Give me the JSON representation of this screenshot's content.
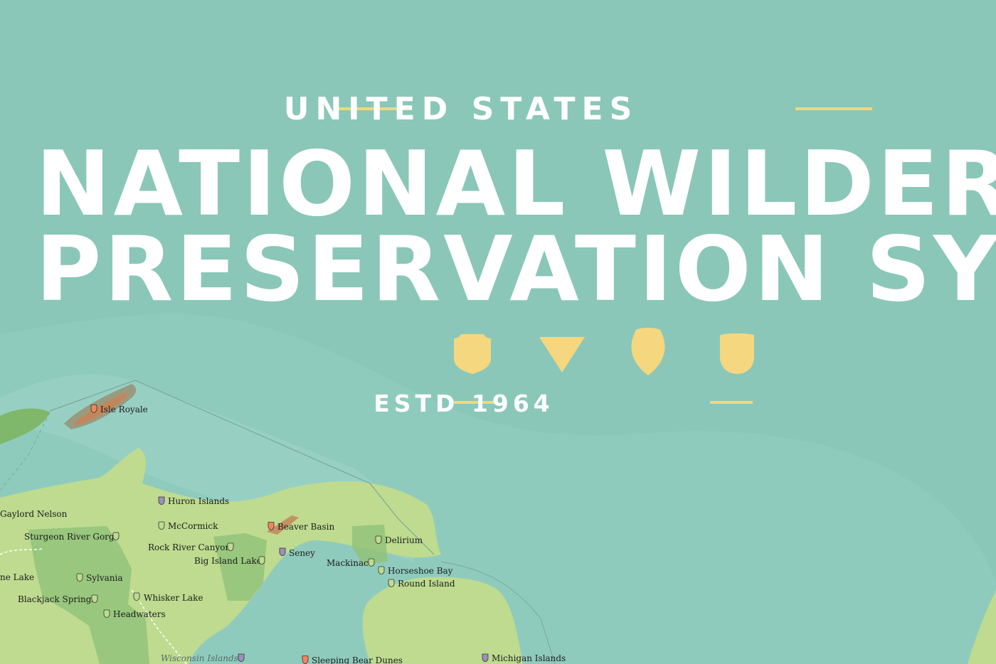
{
  "title": {
    "country": "UNITED STATES",
    "line1": "NATIONAL WILDERNESS",
    "line2": "PRESERVATION SYSTEM",
    "established": "ESTD 1964"
  },
  "colors": {
    "water": "#8fcbbd",
    "land_light": "#bedb8f",
    "land_forest": "#92c37a",
    "title_text": "#ffffff",
    "accent_gold": "#f4d77e",
    "nps_marker": "#f0865c",
    "fws_marker": "#9b8fc0",
    "usfs_marker": "#bedb8f"
  },
  "agency_icons": [
    "usfs-shield-icon",
    "triangle-icon",
    "nps-arrowhead-icon",
    "fws-shield-icon"
  ],
  "areas": [
    {
      "name": "Isle Royale",
      "marker": "nps"
    },
    {
      "name": "Huron Islands",
      "marker": "fws"
    },
    {
      "name": "Gaylord Nelson",
      "marker": "nps"
    },
    {
      "name": "McCormick",
      "marker": "usfs"
    },
    {
      "name": "Beaver Basin",
      "marker": "nps"
    },
    {
      "name": "Sturgeon River Gorge",
      "marker": "usfs"
    },
    {
      "name": "Delirium",
      "marker": "usfs"
    },
    {
      "name": "Rock River Canyon",
      "marker": "usfs"
    },
    {
      "name": "Seney",
      "marker": "fws"
    },
    {
      "name": "Big Island Lake",
      "marker": "usfs"
    },
    {
      "name": "Mackinac",
      "marker": "usfs"
    },
    {
      "name": "Horseshoe Bay",
      "marker": "usfs"
    },
    {
      "name": "ne Lake",
      "marker": "none"
    },
    {
      "name": "Sylvania",
      "marker": "usfs"
    },
    {
      "name": "Round Island",
      "marker": "usfs"
    },
    {
      "name": "Blackjack Springs",
      "marker": "usfs"
    },
    {
      "name": "Whisker Lake",
      "marker": "usfs"
    },
    {
      "name": "Headwaters",
      "marker": "usfs"
    },
    {
      "name": "Wisconsin Islands",
      "marker": "fws"
    },
    {
      "name": "Sleeping Bear Dunes",
      "marker": "nps"
    },
    {
      "name": "Michigan Islands",
      "marker": "fws"
    }
  ]
}
